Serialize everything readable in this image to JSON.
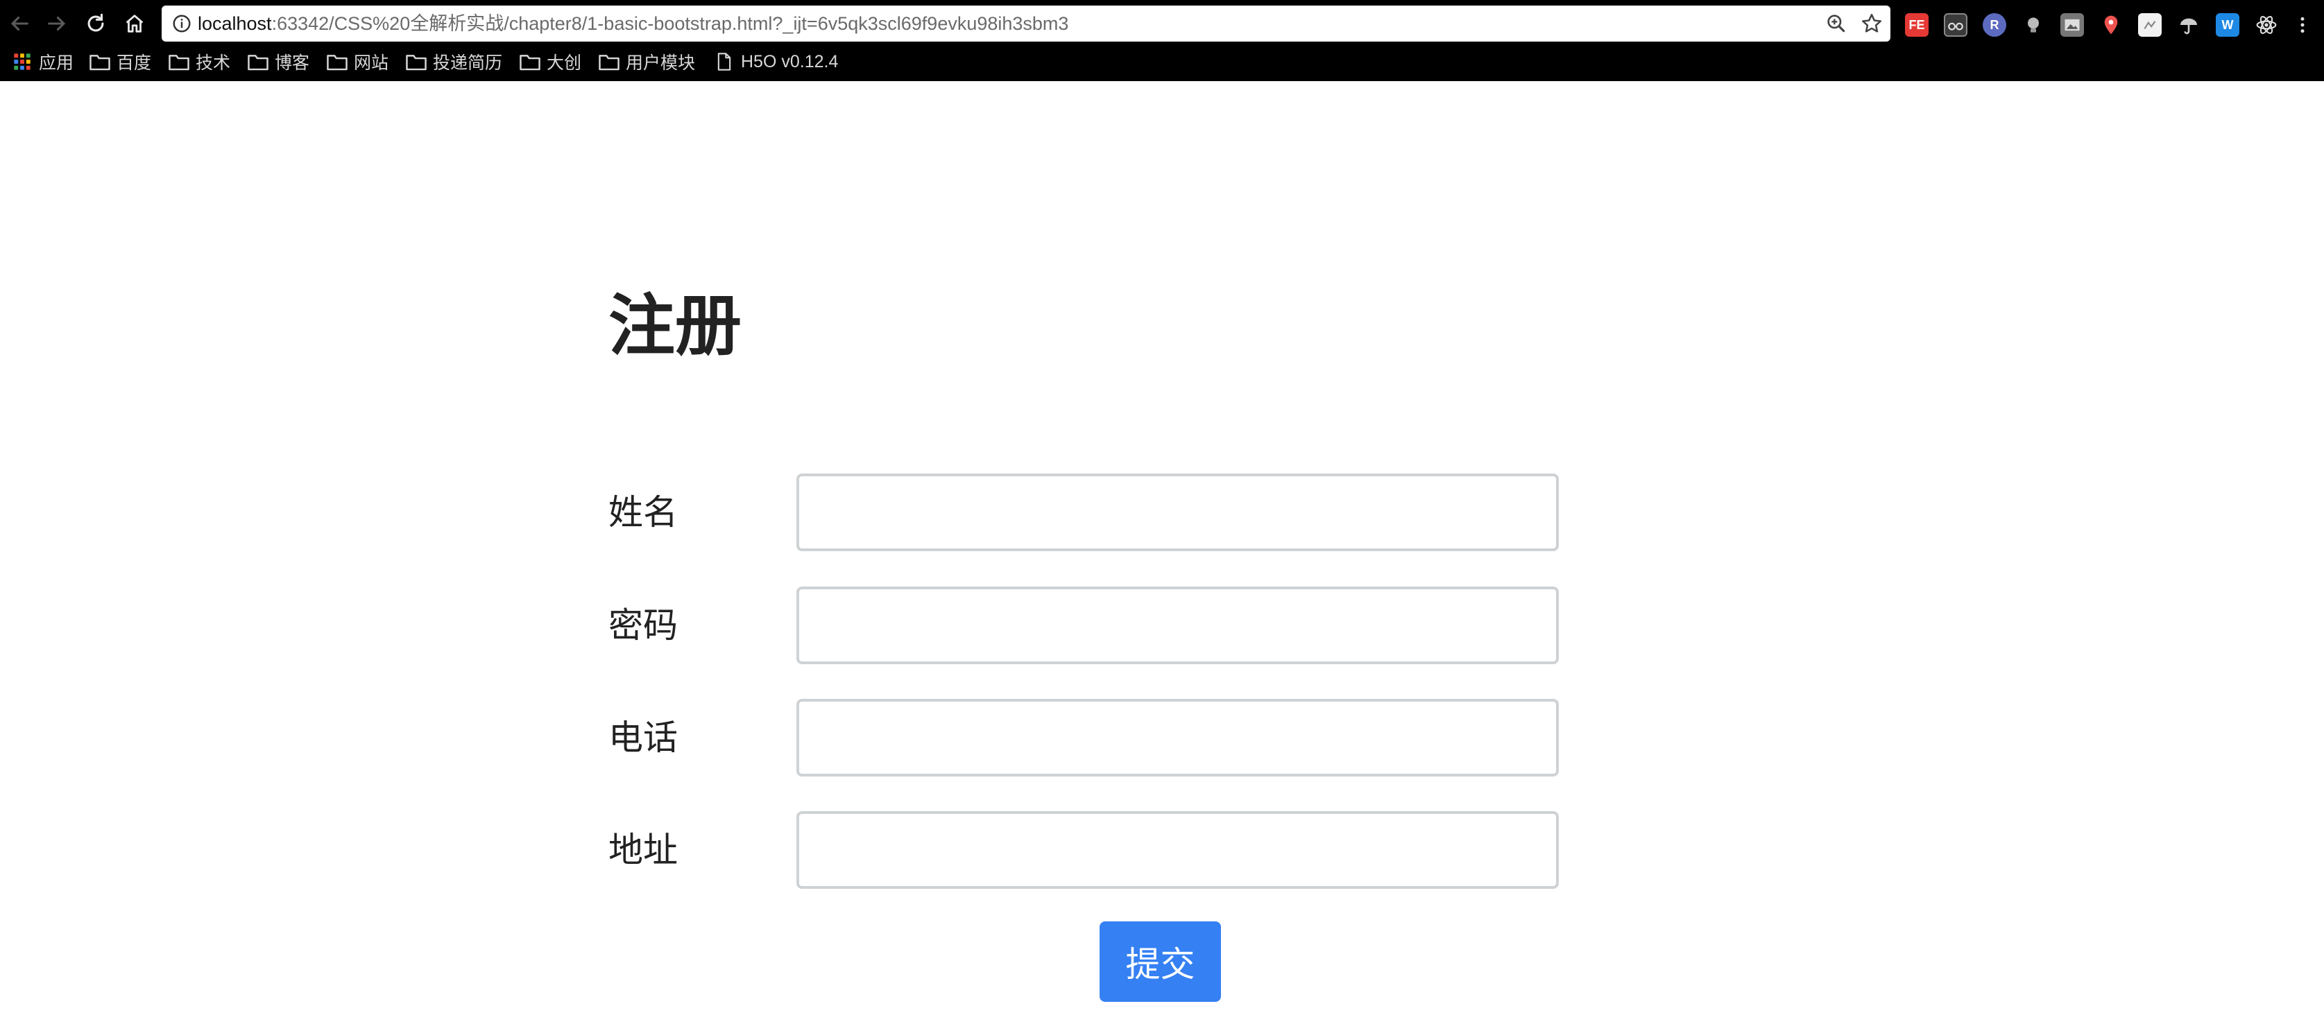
{
  "browser": {
    "address_bar": {
      "host": "localhost",
      "rest": ":63342/CSS%20全解析实战/chapter8/1-basic-bootstrap.html?_ijt=6v5qk3scl69f9evku98ih3sbm3"
    },
    "extensions": [
      {
        "icon": "fe-extension-icon",
        "label": "FE",
        "color": "#e53935"
      },
      {
        "icon": "glasses-extension-icon",
        "label": "",
        "color": "#444444"
      },
      {
        "icon": "react-devtools-extension-icon",
        "label": "R",
        "color": "#5c6bc0"
      },
      {
        "icon": "bulb-extension-icon",
        "label": "",
        "color": "#555555"
      },
      {
        "icon": "picture-extension-icon",
        "label": "",
        "color": "#666666"
      },
      {
        "icon": "location-pin-extension-icon",
        "label": "",
        "color": "#ef5350"
      },
      {
        "icon": "whiteboard-extension-icon",
        "label": "",
        "color": "#eeeeee"
      },
      {
        "icon": "umbrella-extension-icon",
        "label": "",
        "color": "#333333"
      },
      {
        "icon": "w-extension-icon",
        "label": "W",
        "color": "#1e88e5"
      },
      {
        "icon": "react-atom-extension-icon",
        "label": "",
        "color": "#000000"
      }
    ]
  },
  "bookmarks": {
    "apps": "应用",
    "items": [
      "百度",
      "技术",
      "博客",
      "网站",
      "投递简历",
      "大创",
      "用户模块"
    ],
    "page_item": "H5O v0.12.4"
  },
  "form": {
    "title": "注册",
    "fields": [
      {
        "label": "姓名",
        "value": ""
      },
      {
        "label": "密码",
        "value": ""
      },
      {
        "label": "电话",
        "value": ""
      },
      {
        "label": "地址",
        "value": ""
      }
    ],
    "submit_label": "提交"
  },
  "colors": {
    "chrome_bg": "#000000",
    "primary_button": "#3580f3",
    "input_border": "#cfd2d4",
    "text": "#222222"
  }
}
